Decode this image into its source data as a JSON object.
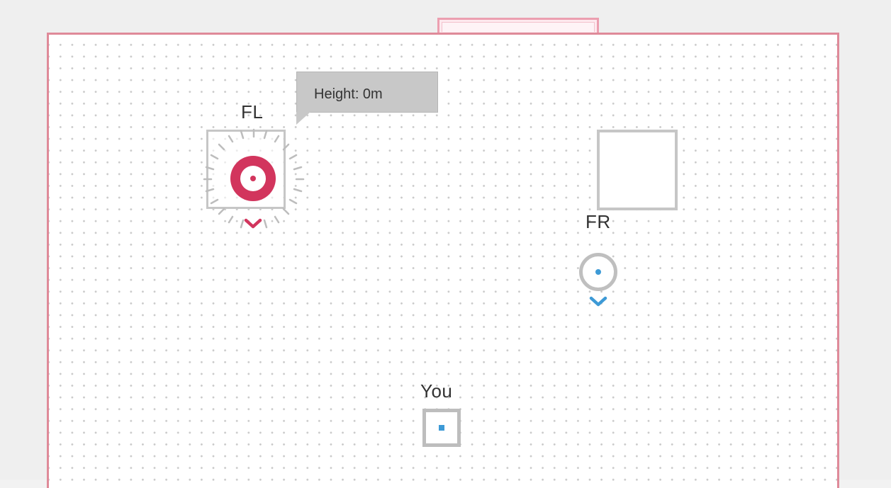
{
  "room": {
    "tooltip": {
      "text": "Height: 0m"
    },
    "speakers": {
      "front_left": {
        "label": "FL"
      },
      "front_right": {
        "label": "FR"
      }
    },
    "listener": {
      "label": "You"
    }
  },
  "colors": {
    "room_border": "#df8a99",
    "selected_accent": "#d2355d",
    "position_dot": "#3d9ad6",
    "inactive_gray": "#c6c6c6",
    "background": "#efefef"
  },
  "icons": {
    "selected_speaker": "target-icon",
    "front_right_speaker": "speaker-icon",
    "listener": "listener-icon",
    "down_arrow": "chevron-down-icon"
  }
}
